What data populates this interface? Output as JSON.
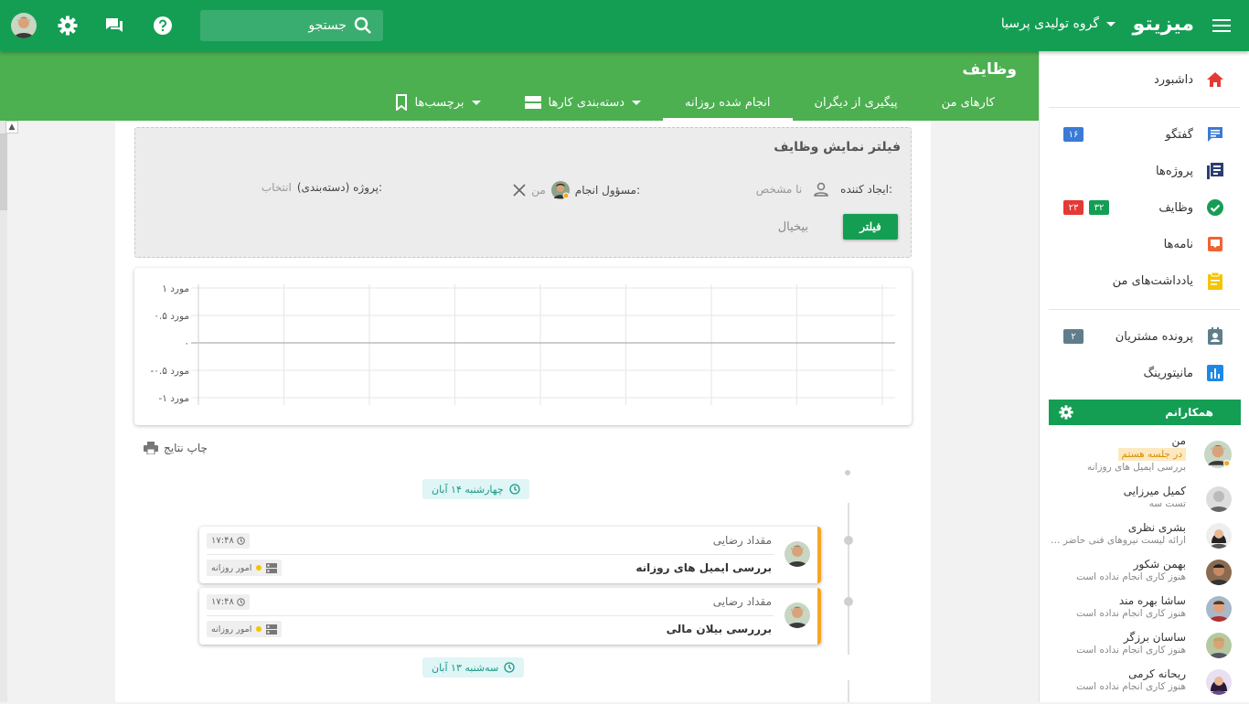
{
  "topbar": {
    "brand": "میزیتو",
    "org_name": "گروه تولیدی پرسیا",
    "search_placeholder": "جستجو",
    "colors": {
      "primary": "#149e54",
      "secondary": "#4caf50"
    }
  },
  "page": {
    "title": "وظایف",
    "tabs": [
      {
        "label": "کارهای من"
      },
      {
        "label": "پیگیری از دیگران"
      },
      {
        "label": "انجام شده روزانه"
      },
      {
        "label": "دسته‌بندی کارها"
      },
      {
        "label": "برچسب‌ها"
      }
    ]
  },
  "filter": {
    "title": "فیلتر نمایش وظایف",
    "creator_label": "ایجاد کننده:",
    "creator_value": "نا مشخص",
    "assignee_label": "مسؤول انجام:",
    "assignee_value": "من",
    "project_label": "پروژه (دسته‌بندی):",
    "project_value": "انتخاب",
    "submit_label": "فیلتر",
    "cancel_label": "بیخیال"
  },
  "chart_data": {
    "type": "line",
    "title": "",
    "xlabel": "",
    "ylabel": "",
    "ylim": [
      -1,
      1
    ],
    "yticks": [
      {
        "value": 1,
        "label": "۱ مورد"
      },
      {
        "value": 0.5,
        "label": "۰.۵ مورد"
      },
      {
        "value": 0,
        "label": "۰"
      },
      {
        "value": -0.5,
        "label": "-۰.۵ مورد"
      },
      {
        "value": -1,
        "label": "-۱ مورد"
      }
    ],
    "grid": true,
    "series": []
  },
  "print_label": "چاپ نتایج",
  "timeline": {
    "groups": [
      {
        "date": "چهارشنبه ۱۴ آبان",
        "tasks": [
          {
            "user": "مقداد رضایی",
            "title": "بررسی ایمیل های روزانه",
            "time": "۱۷:۴۸",
            "category": "امور روزانه"
          },
          {
            "user": "مقداد رضایی",
            "title": "برررسی بیلان مالی",
            "time": "۱۷:۴۸",
            "category": "امور روزانه"
          }
        ]
      },
      {
        "date": "سه‌شنبه ۱۳ آبان",
        "tasks": []
      }
    ]
  },
  "sidebar": {
    "items": [
      {
        "label": "داشبورد",
        "icon": "home-icon"
      },
      {
        "label": "گفتگو",
        "icon": "chat-icon",
        "badges": [
          {
            "text": "۱۶",
            "color": "#3a7bd5"
          }
        ]
      },
      {
        "label": "پروژه‌ها",
        "icon": "projects-icon"
      },
      {
        "label": "وظایف",
        "icon": "check-circle-icon",
        "badges": [
          {
            "text": "۳۲",
            "color": "#149e54"
          },
          {
            "text": "۲۳",
            "color": "#e53935"
          }
        ]
      },
      {
        "label": "نامه‌ها",
        "icon": "inbox-icon"
      },
      {
        "label": "یادداشت‌های من",
        "icon": "notes-icon"
      },
      {
        "label": "پرونده مشتریان",
        "icon": "contacts-icon",
        "badges": [
          {
            "text": "۲",
            "color": "#607d8b"
          }
        ]
      },
      {
        "label": "مانیتورینگ",
        "icon": "monitoring-icon"
      }
    ],
    "colleagues_title": "همکارانم",
    "colleagues": [
      {
        "name": "من",
        "badge": "در جلسه هستم",
        "status": "بررسی ایمیل های روزانه"
      },
      {
        "name": "کمیل میرزایی",
        "status": "تست سه"
      },
      {
        "name": "بشری نظری",
        "status": "ارائه لیست نیروهای فنی حاضر در پ..."
      },
      {
        "name": "بهمن شکور",
        "status": "هنوز کاری انجام نداده است"
      },
      {
        "name": "ساشا بهره مند",
        "status": "هنوز کاری انجام نداده است"
      },
      {
        "name": "ساسان برزگر",
        "status": "هنوز کاری انجام نداده است"
      },
      {
        "name": "ریحانه کرمی",
        "status": "هنوز کاری انجام نداده است"
      }
    ]
  }
}
